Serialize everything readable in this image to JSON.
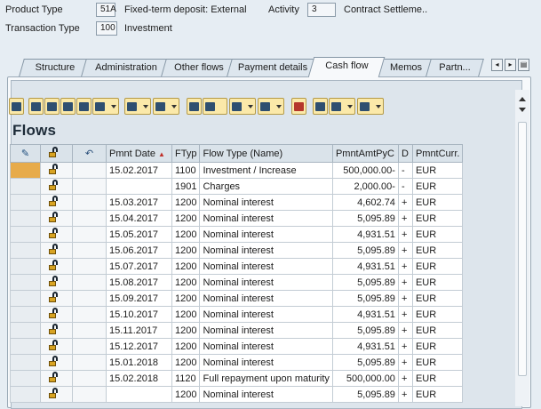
{
  "header": {
    "product_type_label": "Product Type",
    "product_type_value": "51A",
    "product_type_desc": "Fixed-term deposit: External",
    "activity_label": "Activity",
    "activity_value": "3",
    "contract_desc": "Contract Settleme..",
    "transaction_type_label": "Transaction Type",
    "transaction_type_value": "100",
    "transaction_type_desc": "Investment"
  },
  "tabs": [
    {
      "label": "Structure"
    },
    {
      "label": "Administration"
    },
    {
      "label": "Other flows"
    },
    {
      "label": "Payment details"
    },
    {
      "label": "Cash flow"
    },
    {
      "label": "Memos"
    },
    {
      "label": "Partn..."
    }
  ],
  "active_tab": "Cash flow",
  "section_title": "Flows",
  "columns": [
    "",
    "",
    "",
    "Pmnt Date",
    "FTyp",
    "Flow Type (Name)",
    "PmntAmtPyC",
    "D",
    "PmntCurr."
  ],
  "rows": [
    {
      "date": "15.02.2017",
      "ftyp": "1100",
      "name": "Investment / Increase",
      "amt": "500,000.00-",
      "d": "-",
      "cur": "EUR"
    },
    {
      "date": "",
      "ftyp": "1901",
      "name": "Charges",
      "amt": "2,000.00-",
      "d": "-",
      "cur": "EUR"
    },
    {
      "date": "15.03.2017",
      "ftyp": "1200",
      "name": "Nominal interest",
      "amt": "4,602.74",
      "d": "+",
      "cur": "EUR"
    },
    {
      "date": "15.04.2017",
      "ftyp": "1200",
      "name": "Nominal interest",
      "amt": "5,095.89",
      "d": "+",
      "cur": "EUR"
    },
    {
      "date": "15.05.2017",
      "ftyp": "1200",
      "name": "Nominal interest",
      "amt": "4,931.51",
      "d": "+",
      "cur": "EUR"
    },
    {
      "date": "15.06.2017",
      "ftyp": "1200",
      "name": "Nominal interest",
      "amt": "5,095.89",
      "d": "+",
      "cur": "EUR"
    },
    {
      "date": "15.07.2017",
      "ftyp": "1200",
      "name": "Nominal interest",
      "amt": "4,931.51",
      "d": "+",
      "cur": "EUR"
    },
    {
      "date": "15.08.2017",
      "ftyp": "1200",
      "name": "Nominal interest",
      "amt": "5,095.89",
      "d": "+",
      "cur": "EUR"
    },
    {
      "date": "15.09.2017",
      "ftyp": "1200",
      "name": "Nominal interest",
      "amt": "5,095.89",
      "d": "+",
      "cur": "EUR"
    },
    {
      "date": "15.10.2017",
      "ftyp": "1200",
      "name": "Nominal interest",
      "amt": "4,931.51",
      "d": "+",
      "cur": "EUR"
    },
    {
      "date": "15.11.2017",
      "ftyp": "1200",
      "name": "Nominal interest",
      "amt": "5,095.89",
      "d": "+",
      "cur": "EUR"
    },
    {
      "date": "15.12.2017",
      "ftyp": "1200",
      "name": "Nominal interest",
      "amt": "4,931.51",
      "d": "+",
      "cur": "EUR"
    },
    {
      "date": "15.01.2018",
      "ftyp": "1200",
      "name": "Nominal interest",
      "amt": "5,095.89",
      "d": "+",
      "cur": "EUR"
    },
    {
      "date": "15.02.2018",
      "ftyp": "1120",
      "name": "Full repayment upon maturity",
      "amt": "500,000.00",
      "d": "+",
      "cur": "EUR"
    },
    {
      "date": "",
      "ftyp": "1200",
      "name": "Nominal interest",
      "amt": "5,095.89",
      "d": "+",
      "cur": "EUR"
    }
  ],
  "icons": {
    "pencil": "pencil-icon",
    "lock": "lock-icon",
    "undo": "undo-icon",
    "sort": "sort-descending-icon"
  },
  "colors": {
    "background": "#e6edf3",
    "toolbar_button": "#fbe9a9",
    "selected_cell": "#e7ab4a",
    "lock_body": "#d8a322"
  }
}
